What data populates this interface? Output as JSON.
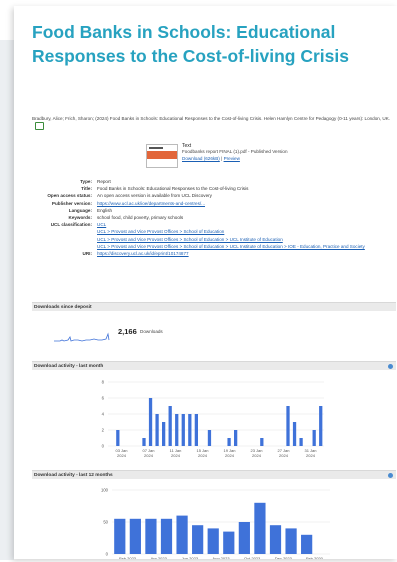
{
  "page": {
    "title": "Food Banks in Schools: Educational Responses to the Cost-of-living Crisis",
    "citation": "Bradbury, Alice; Frich, Sharon; (2024) Food Banks in Schools: Educational Responses to the Cost-of-living Crisis. Helen Hamlyn Centre for Pedagogy (0-11 years): London, UK.",
    "file": {
      "type": "Text",
      "description": "Foodbanks report FINAL (1).pdf - Published Version",
      "download": "Download (626kB)",
      "preview": "Preview"
    }
  },
  "metadata": [
    {
      "key": "Type:",
      "value": "Report",
      "link": false
    },
    {
      "key": "Title:",
      "value": "Food Banks in Schools: Educational Responses to the Cost-of-living Crisis",
      "link": false
    },
    {
      "key": "Open access status:",
      "value": "An open access version is available from UCL Discovery",
      "link": false
    },
    {
      "key": "Publisher version:",
      "value": "https://www.ucl.ac.uk/ioe/departments-and-centres/...",
      "link": true
    },
    {
      "key": "Language:",
      "value": "English",
      "link": false
    },
    {
      "key": "Keywords:",
      "value": "school food, child poverty, primary schools",
      "link": false
    },
    {
      "key": "UCL classification:",
      "lines": [
        "UCL",
        "UCL > Provost and Vice Provost Offices > School of Education",
        "UCL > Provost and Vice Provost Offices > School of Education > UCL Institute of Education",
        "UCL > Provost and Vice Provost Offices > School of Education > UCL Institute of Education > IOE - Education, Practice and Society"
      ],
      "link": true
    },
    {
      "key": "URI:",
      "value": "https://discovery.ucl.ac.uk/id/eprint/10174877",
      "link": true
    }
  ],
  "downloads": {
    "heading": "Downloads since deposit",
    "count": "2,166",
    "label": "Downloads"
  },
  "charts": [
    {
      "heading": "Download activity - last month",
      "chart_data": {
        "type": "bar",
        "ylim": [
          0,
          8
        ],
        "yticks": [
          "0",
          "2",
          "4",
          "6",
          "8"
        ],
        "xticks": [
          "03 Jan 2024",
          "07 Jan 2024",
          "11 Jan 2024",
          "15 Jan 2024",
          "19 Jan 2024",
          "23 Jan 2024",
          "27 Jan 2024",
          "31 Jan 2024"
        ],
        "values": [
          0,
          2,
          0,
          0,
          0,
          1,
          6,
          4,
          3,
          5,
          4,
          4,
          4,
          4,
          0,
          2,
          0,
          0,
          1,
          2,
          0,
          0,
          0,
          1,
          0,
          0,
          0,
          5,
          3,
          1,
          0,
          2,
          5
        ],
        "color": "#3f72d9"
      }
    },
    {
      "heading": "Download activity - last 12 months",
      "chart_data": {
        "type": "bar",
        "ylim": [
          0,
          100
        ],
        "yticks": [
          "0",
          "50",
          "100"
        ],
        "xticks": [
          "Feb 2023",
          "Apr 2023",
          "Jun 2023",
          "Aug 2023",
          "Oct 2023",
          "Dec 2023",
          "Feb 2020"
        ],
        "values": [
          55,
          55,
          55,
          55,
          60,
          45,
          40,
          35,
          50,
          80,
          45,
          40,
          30,
          0
        ],
        "color": "#3f72d9"
      }
    }
  ]
}
